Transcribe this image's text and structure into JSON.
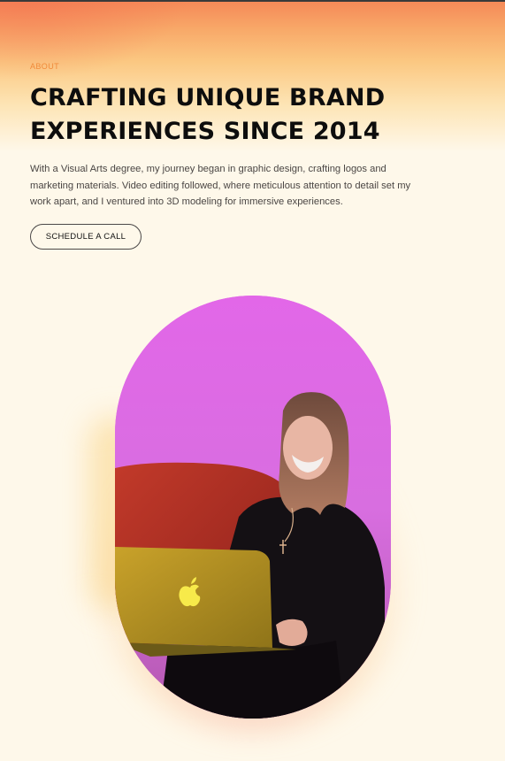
{
  "about": {
    "eyebrow": "ABOUT",
    "title_lines": [
      "CRAFTING UNIQUE BRAND",
      "EXPERIENCES SINCE 2014"
    ],
    "body_lines": [
      "With a Visual Arts degree, my journey began in graphic design, crafting logos and",
      "marketing materials. Video editing followed, where meticulous attention to detail set my",
      "work apart, and I ventured into 3D modeling for immersive experiences."
    ],
    "cta_label": "SCHEDULE A CALL"
  },
  "colors": {
    "accent": "#f08a3a",
    "background": "#fef8ea",
    "portrait_bg": "#e066e6"
  },
  "portrait": {
    "icon": "apple-logo-icon"
  }
}
